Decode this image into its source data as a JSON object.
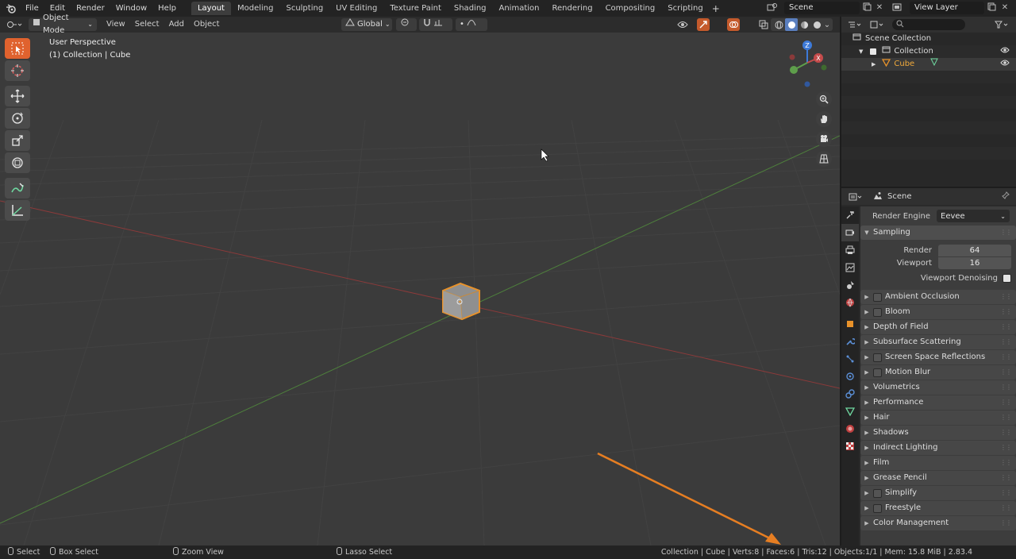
{
  "topbar": {
    "menus": [
      "File",
      "Edit",
      "Render",
      "Window",
      "Help"
    ],
    "workspaces": [
      "Layout",
      "Modeling",
      "Sculpting",
      "UV Editing",
      "Texture Paint",
      "Shading",
      "Animation",
      "Rendering",
      "Compositing",
      "Scripting"
    ],
    "active_workspace": "Layout",
    "add_workspace": "+",
    "scene_name": "Scene",
    "view_layer": "View Layer"
  },
  "viewport_header": {
    "mode": "Object Mode",
    "menus": [
      "View",
      "Select",
      "Add",
      "Object"
    ],
    "transform_orientation": "Global"
  },
  "viewport": {
    "view_name": "User Perspective",
    "collection_info": "(1) Collection | Cube",
    "axis_colors": {
      "x": "#c44b4b",
      "y": "#5e9e4b",
      "z": "#3d7ad9"
    },
    "accent": "#e67e22"
  },
  "outliner": {
    "root": "Scene Collection",
    "collection": "Collection",
    "object": "Cube",
    "search_placeholder": ""
  },
  "properties": {
    "context": "Scene",
    "render_engine_label": "Render Engine",
    "render_engine": "Eevee",
    "sampling": {
      "title": "Sampling",
      "render_label": "Render",
      "render_value": "64",
      "viewport_label": "Viewport",
      "viewport_value": "16",
      "denoise_label": "Viewport Denoising"
    },
    "panels": [
      {
        "label": "Ambient Occlusion",
        "checkbox": true
      },
      {
        "label": "Bloom",
        "checkbox": true
      },
      {
        "label": "Depth of Field",
        "checkbox": false
      },
      {
        "label": "Subsurface Scattering",
        "checkbox": false
      },
      {
        "label": "Screen Space Reflections",
        "checkbox": true
      },
      {
        "label": "Motion Blur",
        "checkbox": true
      },
      {
        "label": "Volumetrics",
        "checkbox": false
      },
      {
        "label": "Performance",
        "checkbox": false
      },
      {
        "label": "Hair",
        "checkbox": false
      },
      {
        "label": "Shadows",
        "checkbox": false
      },
      {
        "label": "Indirect Lighting",
        "checkbox": false
      },
      {
        "label": "Film",
        "checkbox": false
      },
      {
        "label": "Grease Pencil",
        "checkbox": false
      },
      {
        "label": "Simplify",
        "checkbox": true
      },
      {
        "label": "Freestyle",
        "checkbox": true
      },
      {
        "label": "Color Management",
        "checkbox": false
      }
    ]
  },
  "statusbar": {
    "select": "Select",
    "box_select": "Box Select",
    "zoom_view": "Zoom View",
    "lasso_select": "Lasso Select",
    "stats": "Collection | Cube | Verts:8 | Faces:6 | Tris:12 | Objects:1/1 | Mem: 15.8 MiB | 2.83.4"
  }
}
